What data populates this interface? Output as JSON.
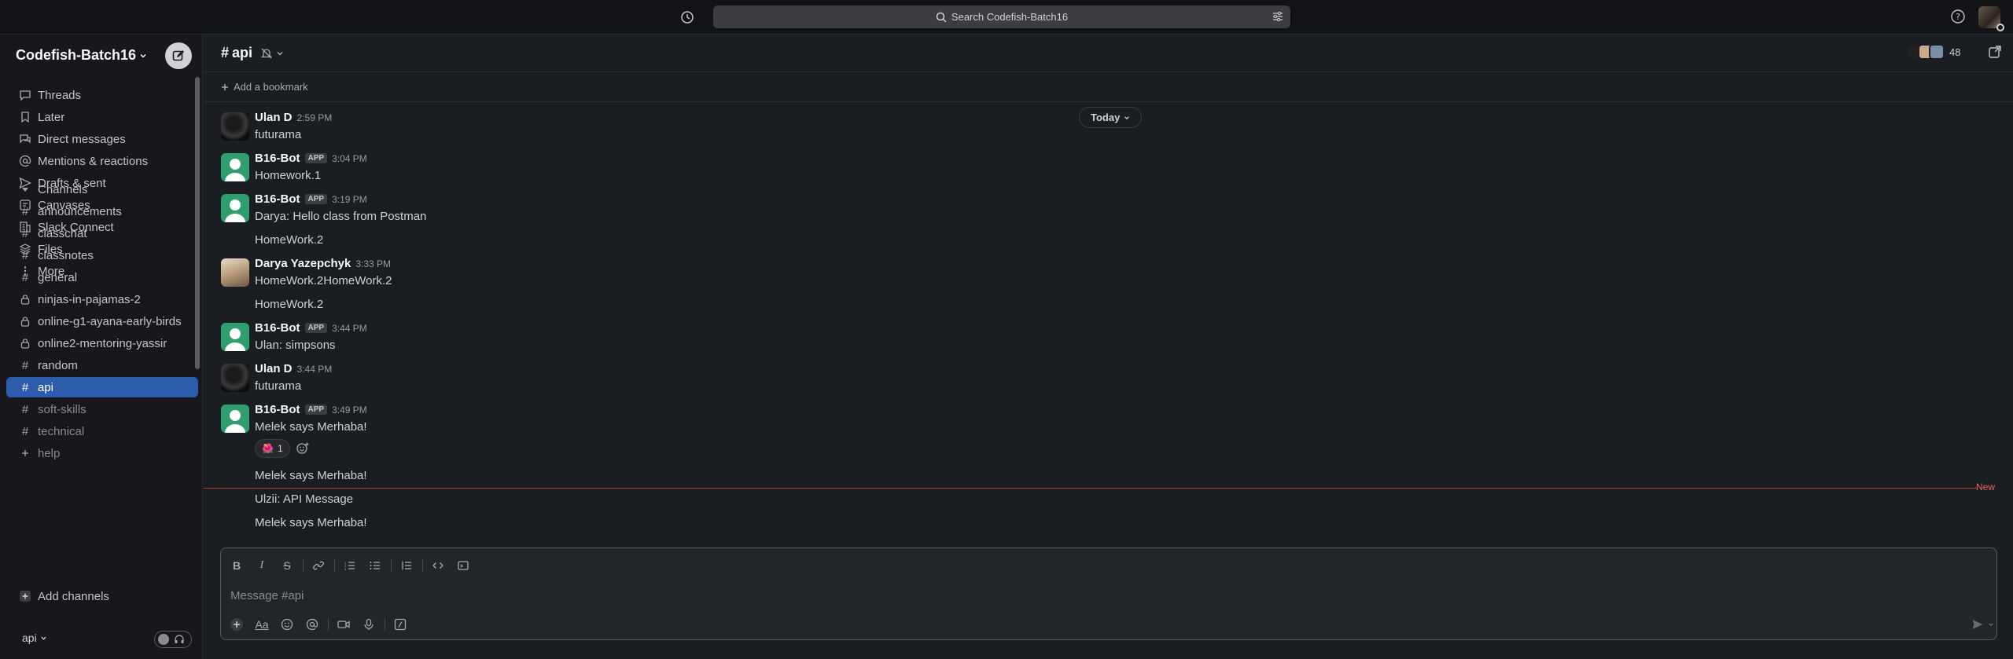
{
  "search": {
    "placeholder": "Search Codefish-Batch16"
  },
  "workspace": {
    "name": "Codefish-Batch16"
  },
  "nav": [
    {
      "label": "Threads",
      "icon": "threads-icon"
    },
    {
      "label": "Later",
      "icon": "bookmark-icon"
    },
    {
      "label": "Direct messages",
      "icon": "dm-icon"
    },
    {
      "label": "Mentions & reactions",
      "icon": "at-icon"
    },
    {
      "label": "Drafts & sent",
      "icon": "send-icon"
    },
    {
      "label": "Canvases",
      "icon": "canvas-icon"
    },
    {
      "label": "Slack Connect",
      "icon": "building-icon"
    },
    {
      "label": "Files",
      "icon": "files-icon"
    },
    {
      "label": "More",
      "icon": "more-icon"
    }
  ],
  "channels_header": "Channels",
  "channels": [
    {
      "label": "announcements",
      "kind": "hash"
    },
    {
      "label": "classchat",
      "kind": "hash"
    },
    {
      "label": "classnotes",
      "kind": "hash"
    },
    {
      "label": "general",
      "kind": "hash"
    },
    {
      "label": "ninjas-in-pajamas-2",
      "kind": "lock"
    },
    {
      "label": "online-g1-ayana-early-birds",
      "kind": "lock"
    },
    {
      "label": "online2-mentoring-yassir",
      "kind": "lock"
    },
    {
      "label": "random",
      "kind": "hash"
    },
    {
      "label": "api",
      "kind": "hash",
      "active": true
    },
    {
      "label": "soft-skills",
      "kind": "hash",
      "dim": true
    },
    {
      "label": "technical",
      "kind": "hash",
      "dim": true
    },
    {
      "label": "help",
      "kind": "plus",
      "dim": true
    }
  ],
  "add_channels": "Add channels",
  "footer": {
    "channel": "api"
  },
  "header": {
    "hash": "#",
    "channel": "api",
    "member_count": "48"
  },
  "bookmark": {
    "label": "Add a bookmark"
  },
  "date_divider": "Today",
  "messages": [
    {
      "author": "Ulan D",
      "app": "",
      "time": "2:59 PM",
      "lines": [
        "futurama"
      ]
    },
    {
      "author": "B16-Bot",
      "app": "APP",
      "time": "3:04 PM",
      "lines": [
        "Homework.1"
      ]
    },
    {
      "author": "B16-Bot",
      "app": "APP",
      "time": "3:19 PM",
      "lines": [
        "Darya: Hello class from Postman",
        "HomeWork.2"
      ]
    },
    {
      "author": "Darya Yazepchyk",
      "app": "",
      "time": "3:33 PM",
      "lines": [
        "HomeWork.2HomeWork.2",
        "HomeWork.2"
      ]
    },
    {
      "author": "B16-Bot",
      "app": "APP",
      "time": "3:44 PM",
      "lines": [
        "Ulan: simpsons"
      ]
    },
    {
      "author": "Ulan D",
      "app": "",
      "time": "3:44 PM",
      "lines": [
        "futurama"
      ]
    },
    {
      "author": "B16-Bot",
      "app": "APP",
      "time": "3:49 PM",
      "lines": [
        "Melek says Merhaba!",
        "Melek says Merhaba!",
        "Ulzii: API Message",
        "Melek says Merhaba!"
      ]
    }
  ],
  "reaction": {
    "emoji": "🌺",
    "count": "1"
  },
  "new_label": "New",
  "composer": {
    "placeholder": "Message #api"
  },
  "colors": {
    "accent": "#2c5dac",
    "bot_avatar": "#2f9e6f",
    "new_divider": "#c0392b"
  }
}
